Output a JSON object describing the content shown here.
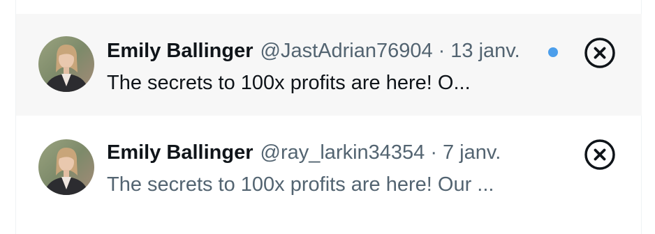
{
  "notifications": [
    {
      "name": "Emily Ballinger",
      "handle": "@JastAdrian76904",
      "separator": "·",
      "date": "13 janv.",
      "preview": "The secrets to 100x profits are here! O...",
      "unread": true,
      "avatar_icon": "user-avatar"
    },
    {
      "name": "Emily Ballinger",
      "handle": "@ray_larkin34354",
      "separator": "·",
      "date": "7 janv.",
      "preview": "The secrets to 100x profits are here! Our ...",
      "unread": false,
      "avatar_icon": "user-avatar"
    }
  ],
  "icons": {
    "dismiss": "close-circle-icon",
    "unread_indicator": "unread-dot-icon"
  },
  "colors": {
    "unread_background": "#f7f7f7",
    "unread_dot": "#4c9eeb",
    "primary_text": "#0f1419",
    "secondary_text": "#536471"
  }
}
